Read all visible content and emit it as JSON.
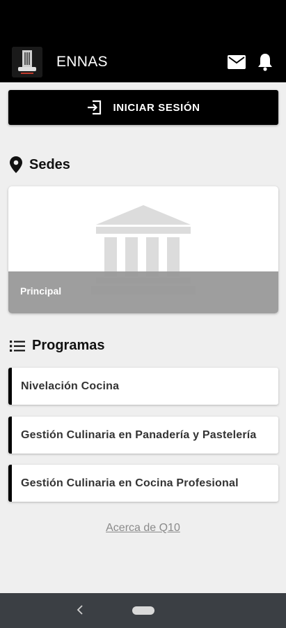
{
  "app_bar": {
    "title": "ENNAS",
    "logo_icon": "ennas-logo-icon",
    "mail_icon": "mail-icon",
    "bell_icon": "bell-icon"
  },
  "login": {
    "label": "INICIAR SESIÓN",
    "icon": "login-icon"
  },
  "sedes": {
    "title": "Sedes",
    "icon": "location-pin-icon",
    "items": [
      {
        "name": "Principal",
        "image_icon": "building-icon"
      }
    ]
  },
  "programas": {
    "title": "Programas",
    "icon": "list-icon",
    "items": [
      {
        "label": "Nivelación Cocina"
      },
      {
        "label": "Gestión Culinaria en Panadería y Pastelería"
      },
      {
        "label": "Gestión Culinaria en Cocina Profesional"
      }
    ]
  },
  "footer_link": "Acerca de Q10",
  "colors": {
    "app_bar": "#000000",
    "background": "#efefef",
    "nav_bar": "#3b3f44",
    "accent": "#000000"
  }
}
